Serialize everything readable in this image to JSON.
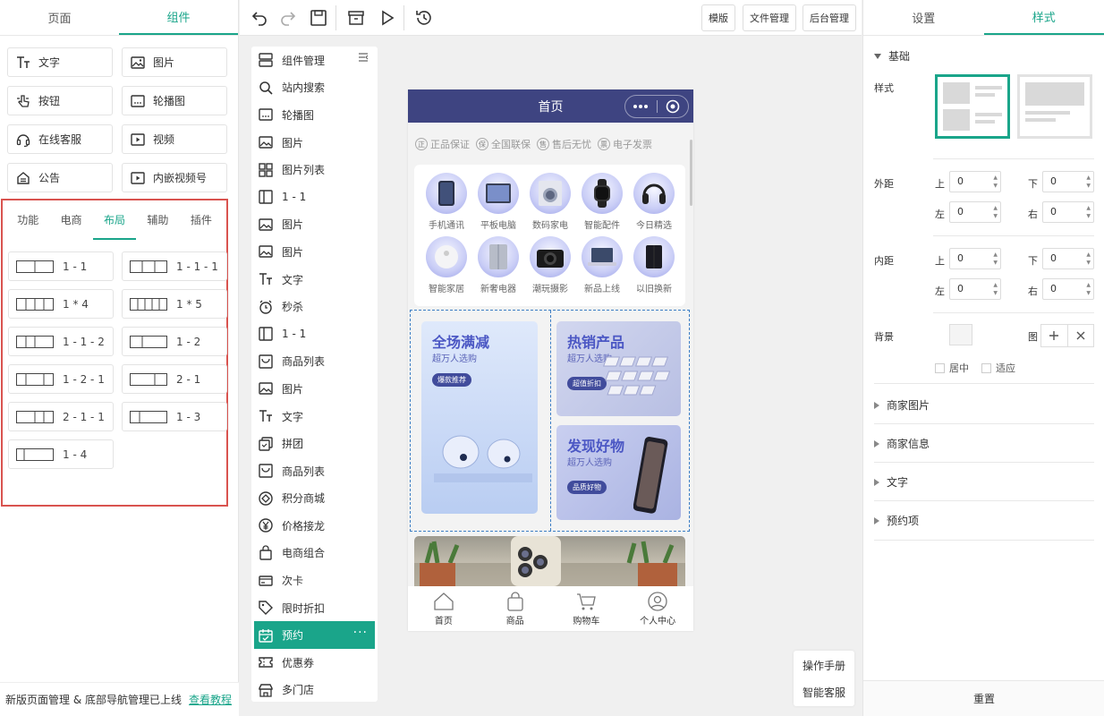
{
  "left_panel": {
    "tabs": [
      {
        "label": "页面"
      },
      {
        "label": "组件"
      }
    ],
    "basic_components": [
      {
        "label": "文字",
        "icon": "text-icon"
      },
      {
        "label": "图片",
        "icon": "image-icon"
      },
      {
        "label": "按钮",
        "icon": "button-icon"
      },
      {
        "label": "轮播图",
        "icon": "carousel-icon"
      },
      {
        "label": "在线客服",
        "icon": "headset-icon"
      },
      {
        "label": "视频",
        "icon": "video-icon"
      },
      {
        "label": "公告",
        "icon": "notice-icon"
      },
      {
        "label": "内嵌视频号",
        "icon": "video-icon"
      }
    ],
    "category_tabs": [
      {
        "label": "功能"
      },
      {
        "label": "电商"
      },
      {
        "label": "布局"
      },
      {
        "label": "辅助"
      },
      {
        "label": "插件"
      }
    ],
    "layouts": [
      {
        "label": "1 - 1"
      },
      {
        "label": "1 - 1 - 1"
      },
      {
        "label": "1 * 4"
      },
      {
        "label": "1 * 5"
      },
      {
        "label": "1 - 1 - 2"
      },
      {
        "label": "1 - 2"
      },
      {
        "label": "1 - 2 - 1"
      },
      {
        "label": "2 - 1"
      },
      {
        "label": "2 - 1 - 1"
      },
      {
        "label": "1 - 3"
      },
      {
        "label": "1 - 4"
      }
    ],
    "notice": {
      "text": "新版页面管理 & 底部导航管理已上线",
      "link": "查看教程"
    }
  },
  "toolbar": {
    "buttons": {
      "template": "模版",
      "files": "文件管理",
      "admin": "后台管理"
    }
  },
  "component_list": {
    "items": [
      {
        "label": "组件管理"
      },
      {
        "label": "站内搜索"
      },
      {
        "label": "轮播图"
      },
      {
        "label": "图片"
      },
      {
        "label": "图片列表"
      },
      {
        "label": "1 - 1"
      },
      {
        "label": "图片"
      },
      {
        "label": "图片"
      },
      {
        "label": "文字"
      },
      {
        "label": "秒杀"
      },
      {
        "label": "1 - 1"
      },
      {
        "label": "商品列表"
      },
      {
        "label": "图片"
      },
      {
        "label": "文字"
      },
      {
        "label": "拼团"
      },
      {
        "label": "商品列表"
      },
      {
        "label": "积分商城"
      },
      {
        "label": "价格接龙"
      },
      {
        "label": "电商组合"
      },
      {
        "label": "次卡"
      },
      {
        "label": "限时折扣"
      },
      {
        "label": "预约"
      },
      {
        "label": "优惠券"
      },
      {
        "label": "多门店"
      }
    ],
    "more": "···"
  },
  "phone": {
    "title": "首页",
    "guarantees": [
      {
        "label": "正品保证",
        "mark": "正"
      },
      {
        "label": "全国联保",
        "mark": "保"
      },
      {
        "label": "售后无忧",
        "mark": "售"
      },
      {
        "label": "电子发票",
        "mark": "票"
      }
    ],
    "categories": [
      {
        "label": "手机通讯"
      },
      {
        "label": "平板电脑"
      },
      {
        "label": "数码家电"
      },
      {
        "label": "智能配件"
      },
      {
        "label": "今日精选"
      },
      {
        "label": "智能家居"
      },
      {
        "label": "新奢电器"
      },
      {
        "label": "潮玩摄影"
      },
      {
        "label": "新品上线"
      },
      {
        "label": "以旧换新"
      }
    ],
    "promos": [
      {
        "title": "全场满减",
        "sub": "超万人选购",
        "badge": "爆款推荐"
      },
      {
        "title": "热销产品",
        "sub": "超万人选购",
        "badge": "超值折扣"
      },
      {
        "title": "发现好物",
        "sub": "超万人选购",
        "badge": "品质好物"
      }
    ],
    "tabbar": [
      {
        "label": "首页"
      },
      {
        "label": "商品"
      },
      {
        "label": "购物车"
      },
      {
        "label": "个人中心"
      }
    ]
  },
  "floating": {
    "manual": "操作手册",
    "service": "智能客服"
  },
  "right_panel": {
    "tabs": [
      {
        "label": "设置"
      },
      {
        "label": "样式"
      }
    ],
    "basic_section": "基础",
    "style_label": "样式",
    "margin": {
      "label": "外距",
      "top_label": "上",
      "bottom_label": "下",
      "left_label": "左",
      "right_label": "右",
      "top": "0",
      "bottom": "0",
      "left": "0",
      "right": "0"
    },
    "padding": {
      "label": "内距",
      "top_label": "上",
      "bottom_label": "下",
      "left_label": "左",
      "right_label": "右",
      "top": "0",
      "bottom": "0",
      "left": "0",
      "right": "0"
    },
    "background": {
      "label": "背景",
      "image_label": "图",
      "center": "居中",
      "fit": "适应"
    },
    "sections": [
      {
        "label": "商家图片"
      },
      {
        "label": "商家信息"
      },
      {
        "label": "文字"
      },
      {
        "label": "预约项"
      }
    ],
    "reset": "重置"
  },
  "colors": {
    "accent": "#1aa58a",
    "phone_header": "#3e4481",
    "highlight_border": "#d9534f"
  }
}
